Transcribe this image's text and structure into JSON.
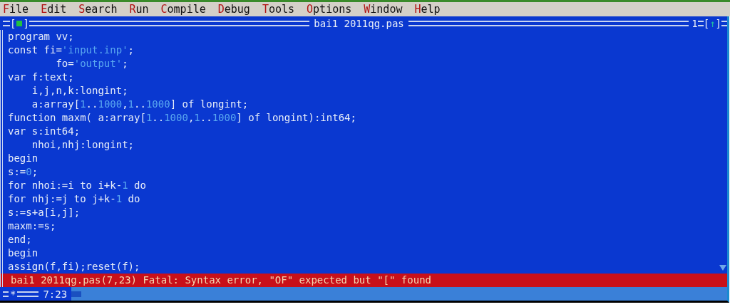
{
  "menu": [
    {
      "hotkey": "F",
      "rest": "ile"
    },
    {
      "hotkey": "E",
      "rest": "dit"
    },
    {
      "hotkey": "S",
      "rest": "earch"
    },
    {
      "hotkey": "R",
      "rest": "un"
    },
    {
      "hotkey": "C",
      "rest": "ompile"
    },
    {
      "hotkey": "D",
      "rest": "ebug"
    },
    {
      "hotkey": "T",
      "rest": "ools"
    },
    {
      "hotkey": "O",
      "rest": "ptions"
    },
    {
      "hotkey": "W",
      "rest": "indow"
    },
    {
      "hotkey": "H",
      "rest": "elp"
    }
  ],
  "window": {
    "title": "bai1 2011qg.pas",
    "close_open": "[",
    "close_close": "]",
    "number": "1",
    "zoom_open": "[",
    "zoom_arrow": "↑",
    "zoom_close": "]",
    "modified": "*",
    "cursor": "7:23"
  },
  "code": [
    [
      {
        "kind": "plain",
        "text": "program vv;"
      }
    ],
    [
      {
        "kind": "plain",
        "text": "const fi="
      },
      {
        "kind": "literal",
        "text": "'input.inp'"
      },
      {
        "kind": "plain",
        "text": ";"
      }
    ],
    [
      {
        "kind": "plain",
        "text": "        fo="
      },
      {
        "kind": "literal",
        "text": "'output'"
      },
      {
        "kind": "plain",
        "text": ";"
      }
    ],
    [
      {
        "kind": "plain",
        "text": "var f:text;"
      }
    ],
    [
      {
        "kind": "plain",
        "text": "    i,j,n,k:longint;"
      }
    ],
    [
      {
        "kind": "plain",
        "text": "    a:array["
      },
      {
        "kind": "literal",
        "text": "1"
      },
      {
        "kind": "plain",
        "text": ".."
      },
      {
        "kind": "literal",
        "text": "1000"
      },
      {
        "kind": "plain",
        "text": ","
      },
      {
        "kind": "literal",
        "text": "1"
      },
      {
        "kind": "plain",
        "text": ".."
      },
      {
        "kind": "literal",
        "text": "1000"
      },
      {
        "kind": "plain",
        "text": "] of longint;"
      }
    ],
    [
      {
        "kind": "plain",
        "text": "function maxm( a:array["
      },
      {
        "kind": "literal",
        "text": "1"
      },
      {
        "kind": "plain",
        "text": ".."
      },
      {
        "kind": "literal",
        "text": "1000"
      },
      {
        "kind": "plain",
        "text": ","
      },
      {
        "kind": "literal",
        "text": "1"
      },
      {
        "kind": "plain",
        "text": ".."
      },
      {
        "kind": "literal",
        "text": "1000"
      },
      {
        "kind": "plain",
        "text": "] of longint):int64;"
      }
    ],
    [
      {
        "kind": "plain",
        "text": "var s:int64;"
      }
    ],
    [
      {
        "kind": "plain",
        "text": "    nhoi,nhj:longint;"
      }
    ],
    [
      {
        "kind": "plain",
        "text": "begin"
      }
    ],
    [
      {
        "kind": "plain",
        "text": "s:="
      },
      {
        "kind": "literal",
        "text": "0"
      },
      {
        "kind": "plain",
        "text": ";"
      }
    ],
    [
      {
        "kind": "plain",
        "text": "for nhoi:=i to i+k-"
      },
      {
        "kind": "literal",
        "text": "1"
      },
      {
        "kind": "plain",
        "text": " do"
      }
    ],
    [
      {
        "kind": "plain",
        "text": "for nhj:=j to j+k-"
      },
      {
        "kind": "literal",
        "text": "1"
      },
      {
        "kind": "plain",
        "text": " do"
      }
    ],
    [
      {
        "kind": "plain",
        "text": "s:=s+a[i,j];"
      }
    ],
    [
      {
        "kind": "plain",
        "text": "maxm:=s;"
      }
    ],
    [
      {
        "kind": "plain",
        "text": "end;"
      }
    ],
    [
      {
        "kind": "plain",
        "text": "begin"
      }
    ],
    [
      {
        "kind": "plain",
        "text": "assign(f,fi);reset(f);"
      }
    ]
  ],
  "error": "bai1 2011qg.pas(7,23) Fatal: Syntax error, \"OF\" expected but \"[\" found"
}
